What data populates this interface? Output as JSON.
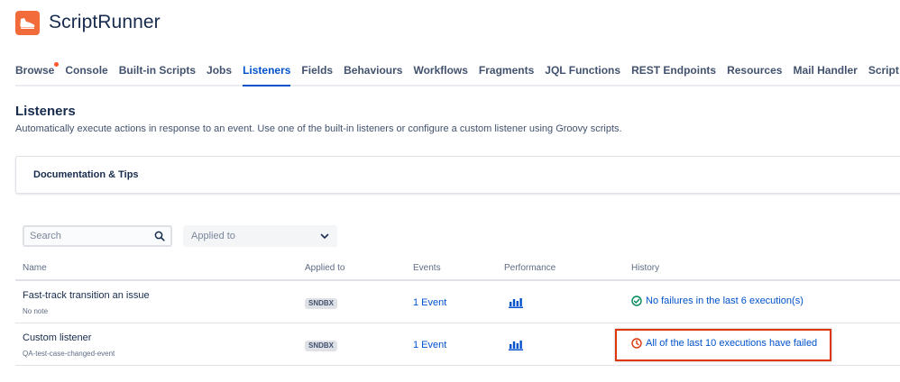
{
  "app": {
    "title": "ScriptRunner",
    "logo_icon": "shoe-icon",
    "brand_color": "#f26b3a"
  },
  "nav": {
    "items": [
      {
        "label": "Browse",
        "badge_dot": true
      },
      {
        "label": "Console"
      },
      {
        "label": "Built-in Scripts"
      },
      {
        "label": "Jobs"
      },
      {
        "label": "Listeners",
        "active": true
      },
      {
        "label": "Fields"
      },
      {
        "label": "Behaviours"
      },
      {
        "label": "Workflows"
      },
      {
        "label": "Fragments"
      },
      {
        "label": "JQL Functions"
      },
      {
        "label": "REST Endpoints"
      },
      {
        "label": "Resources"
      },
      {
        "label": "Mail Handler"
      },
      {
        "label": "Script Editor"
      }
    ]
  },
  "page": {
    "title": "Listeners",
    "description": "Automatically execute actions in response to an event. Use one of the built-in listeners or configure a custom listener using Groovy scripts."
  },
  "docs_panel": {
    "label": "Documentation & Tips"
  },
  "filters": {
    "search_placeholder": "Search",
    "applied_to_placeholder": "Applied to"
  },
  "table": {
    "headers": {
      "name": "Name",
      "applied_to": "Applied to",
      "events": "Events",
      "performance": "Performance",
      "history": "History"
    },
    "rows": [
      {
        "name": "Fast-track transition an issue",
        "note": "No note",
        "applied_to": "SNDBX",
        "events": "1 Event",
        "history": "No failures in the last 6 execution(s)",
        "history_status": "success"
      },
      {
        "name": "Custom listener",
        "note": "QA-test-case-changed-event",
        "applied_to": "SNDBX",
        "events": "1 Event",
        "history": "All of the last 10 executions have failed",
        "history_status": "failed"
      }
    ]
  },
  "colors": {
    "link": "#0052cc",
    "success": "#00875a",
    "error": "#de350b",
    "highlight_border": "#de350b"
  }
}
